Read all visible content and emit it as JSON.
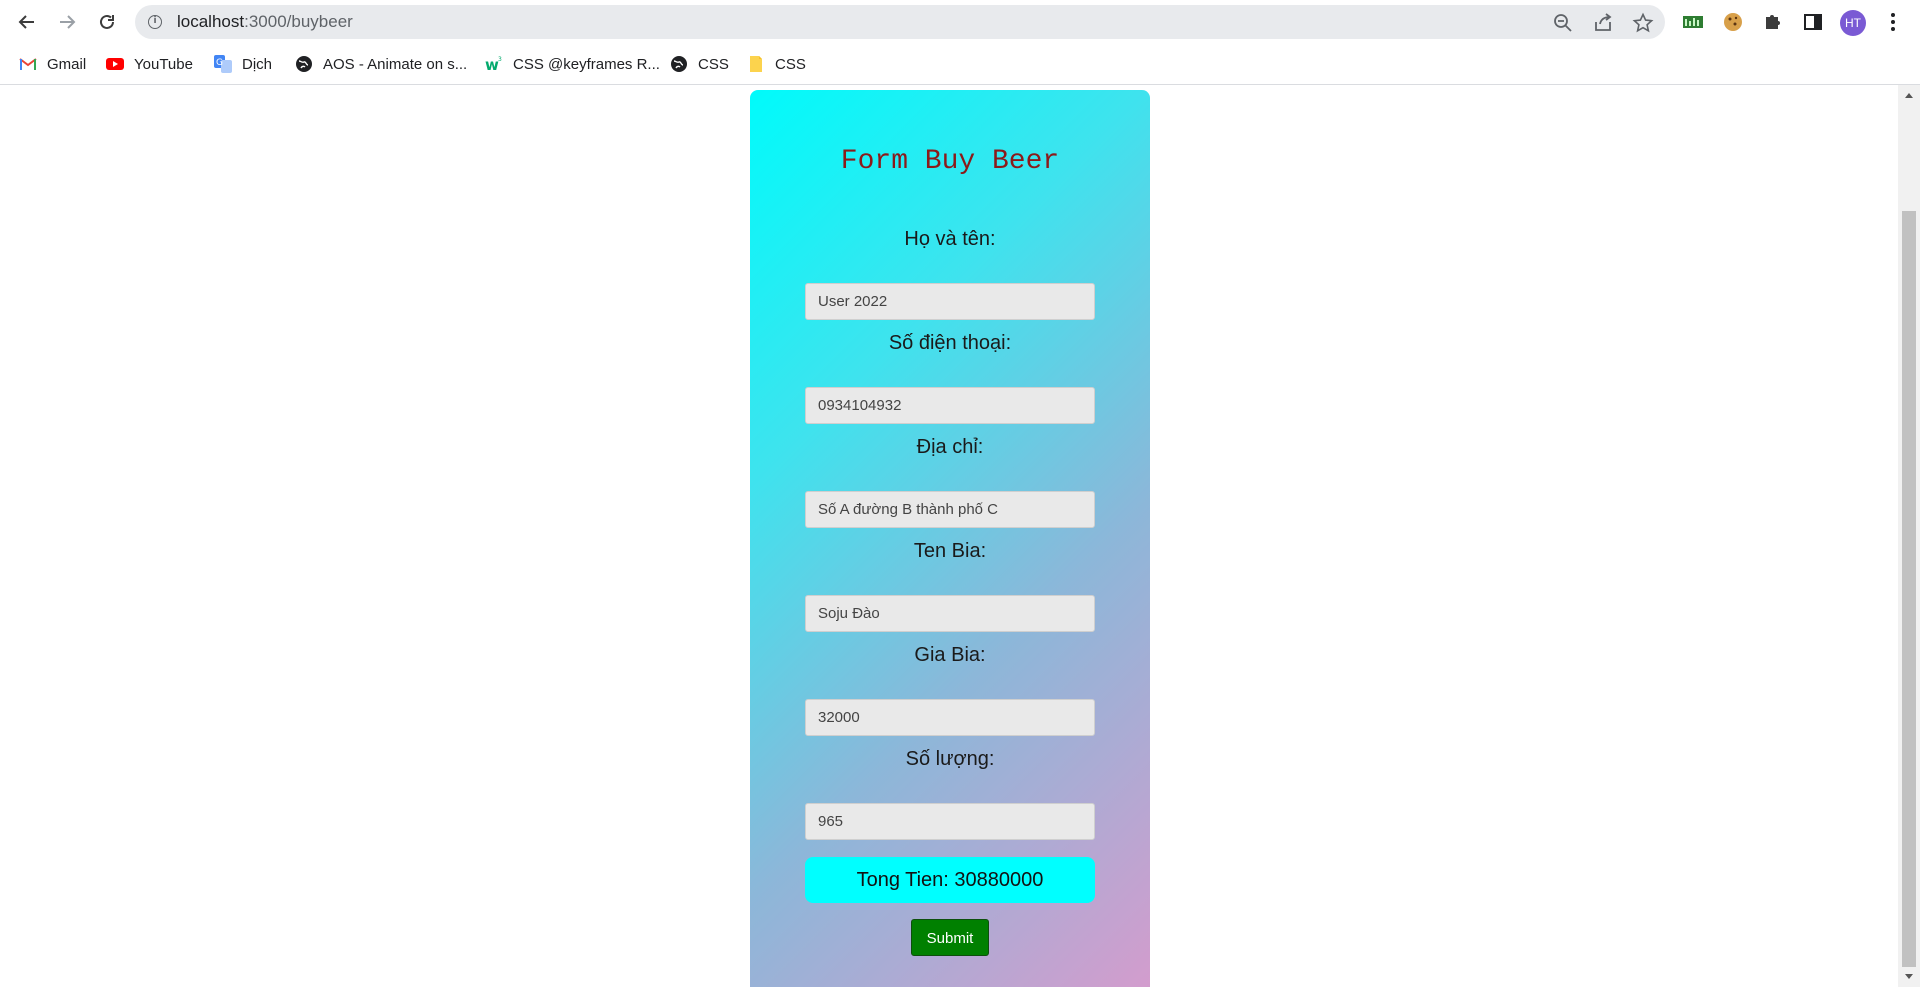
{
  "browser": {
    "url_host": "localhost",
    "url_path": ":3000/buybeer",
    "avatar_initials": "HT"
  },
  "bookmarks": [
    {
      "label": "Gmail",
      "icon": "gmail-icon"
    },
    {
      "label": "YouTube",
      "icon": "youtube-icon"
    },
    {
      "label": "Dịch",
      "icon": "translate-icon"
    },
    {
      "label": "AOS - Animate on s...",
      "icon": "globe-icon"
    },
    {
      "label": "CSS @keyframes R...",
      "icon": "w3schools-icon"
    },
    {
      "label": "CSS",
      "icon": "globe-icon"
    },
    {
      "label": "CSS",
      "icon": "folder-icon"
    }
  ],
  "form": {
    "title": "Form Buy Beer",
    "fields": [
      {
        "label": "Họ và tên:",
        "value": "User 2022"
      },
      {
        "label": "Số điện thoại:",
        "value": "0934104932"
      },
      {
        "label": "Địa chỉ:",
        "value": "Số A đường B thành phố C"
      },
      {
        "label": "Ten Bia:",
        "value": "Soju Đào"
      },
      {
        "label": "Gia Bia:",
        "value": "32000"
      },
      {
        "label": "Số lượng:",
        "value": "965"
      }
    ],
    "total_text": "Tong Tien: 30880000",
    "submit_label": "Submit"
  },
  "colors": {
    "title": "#8b1a1a",
    "total_bg": "#00ffff",
    "submit_bg": "#008000",
    "card_gradient_start": "#00fbfb",
    "card_gradient_end": "#d49ccd"
  }
}
